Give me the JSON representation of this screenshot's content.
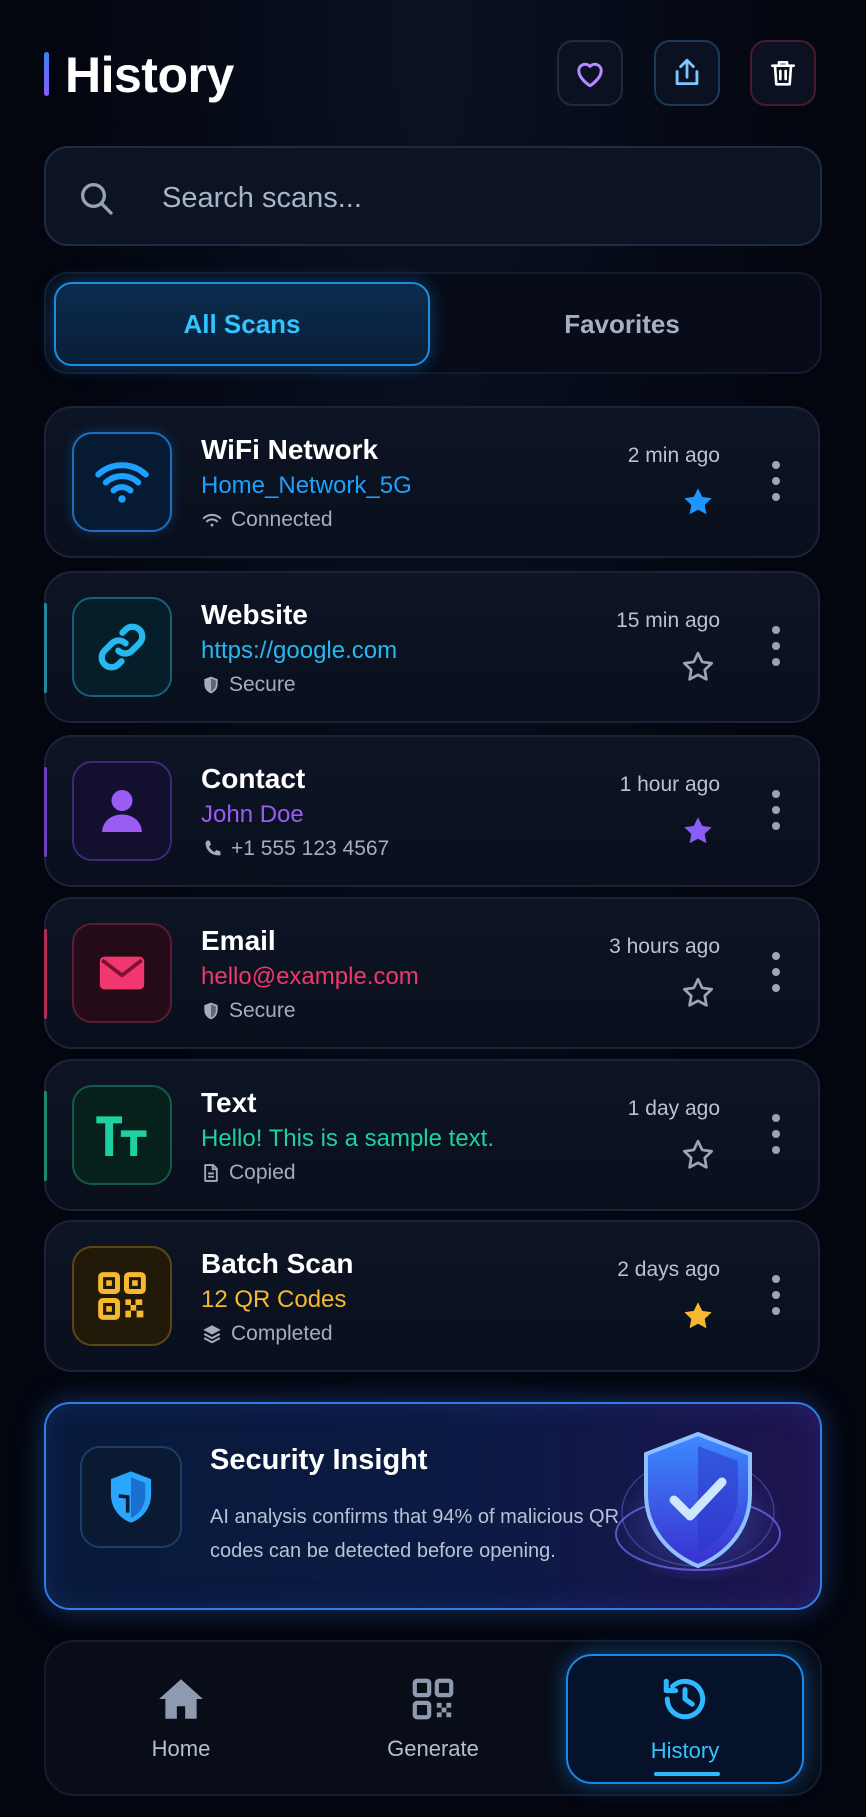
{
  "header": {
    "title": "History"
  },
  "search": {
    "placeholder": "Search scans..."
  },
  "tabs": [
    {
      "label": "All Scans",
      "active": true
    },
    {
      "label": "Favorites",
      "active": false
    }
  ],
  "items": [
    {
      "title": "WiFi Network",
      "subtitle": "Home_Network_5G",
      "meta": "Connected",
      "time": "2 min ago",
      "favorite": true,
      "color": "#1ea0ff",
      "icon": "wifi-icon",
      "meta_icon": "wifi-small-icon"
    },
    {
      "title": "Website",
      "subtitle": "https://google.com",
      "meta": "Secure",
      "time": "15 min ago",
      "favorite": false,
      "color": "#26b9f0",
      "icon": "link-icon",
      "meta_icon": "shield-small-icon"
    },
    {
      "title": "Contact",
      "subtitle": "John Doe",
      "meta": "+1 555 123 4567",
      "time": "1 hour ago",
      "favorite": true,
      "color": "#9b5cf6",
      "icon": "person-icon",
      "meta_icon": "phone-icon"
    },
    {
      "title": "Email",
      "subtitle": "hello@example.com",
      "meta": "Secure",
      "time": "3 hours ago",
      "favorite": false,
      "color": "#f0386e",
      "icon": "envelope-icon",
      "meta_icon": "shield-small-icon"
    },
    {
      "title": "Text",
      "subtitle": "Hello! This is a sample text.",
      "meta": "Copied",
      "time": "1 day ago",
      "favorite": false,
      "color": "#1fd0a0",
      "icon": "text-icon",
      "meta_icon": "document-icon"
    },
    {
      "title": "Batch Scan",
      "subtitle": "12 QR Codes",
      "meta": "Completed",
      "time": "2 days ago",
      "favorite": true,
      "color": "#f5b82e",
      "icon": "qr-code-icon",
      "meta_icon": "layers-icon"
    }
  ],
  "insight": {
    "title": "Security Insight",
    "text": "AI analysis confirms that 94% of malicious QR codes can be detected before opening."
  },
  "nav": [
    {
      "label": "Home",
      "icon": "home-icon",
      "active": false
    },
    {
      "label": "Generate",
      "icon": "qr-generate-icon",
      "active": false
    },
    {
      "label": "History",
      "icon": "history-icon",
      "active": true
    }
  ]
}
